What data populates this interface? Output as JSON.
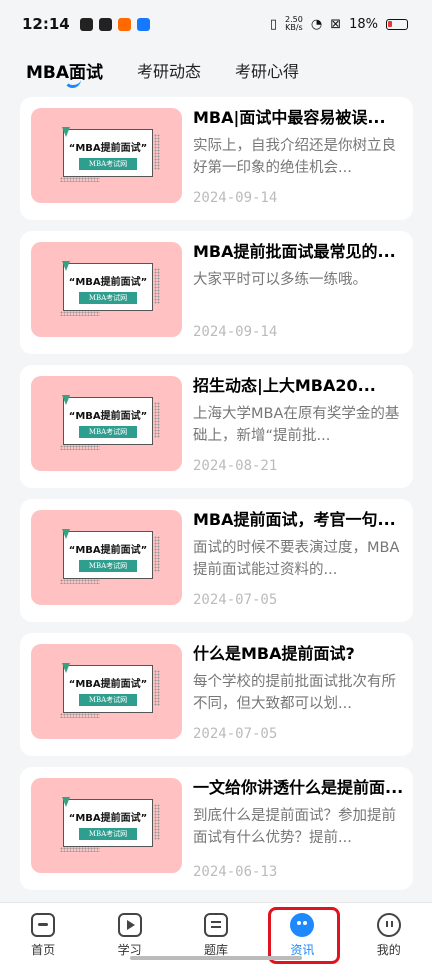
{
  "status": {
    "time": "12:14",
    "speed_value": "2.50",
    "speed_unit": "KB/s",
    "battery": "18%"
  },
  "tabs": [
    {
      "label": "MBA面试",
      "active": true
    },
    {
      "label": "考研动态",
      "active": false
    },
    {
      "label": "考研心得",
      "active": false
    }
  ],
  "thumbnail": {
    "title": "“MBA提前面试”",
    "badge": "MBA考试网"
  },
  "articles": [
    {
      "title": "MBA|面试中最容易被误...",
      "summary": "实际上，自我介绍还是你树立良好第一印象的绝佳机会...",
      "date": "2024-09-14"
    },
    {
      "title": "MBA提前批面试最常见的...",
      "summary": "大家平时可以多练一练哦。",
      "date": "2024-09-14"
    },
    {
      "title": "招生动态|上大MBA20...",
      "summary": "上海大学MBA在原有奖学金的基础上，新增“提前批...",
      "date": "2024-08-21"
    },
    {
      "title": "MBA提前面试，考官一句...",
      "summary": "面试的时候不要表演过度，MBA提前面试能过资料的...",
      "date": "2024-07-05"
    },
    {
      "title": "什么是MBA提前面试?",
      "summary": "每个学校的提前批面试批次有所不同，但大致都可以划...",
      "date": "2024-07-05"
    },
    {
      "title": "一文给你讲透什么是提前面...",
      "summary": "到底什么是提前面试？参加提前面试有什么优势？提前...",
      "date": "2024-06-13"
    }
  ],
  "bottom_nav": [
    {
      "label": "首页",
      "icon": "home-icon",
      "active": false
    },
    {
      "label": "学习",
      "icon": "play-icon",
      "active": false
    },
    {
      "label": "题库",
      "icon": "question-bank-icon",
      "active": false
    },
    {
      "label": "资讯",
      "icon": "news-icon",
      "active": true
    },
    {
      "label": "我的",
      "icon": "profile-icon",
      "active": false
    }
  ],
  "colors": {
    "accent": "#1e88ff",
    "thumbnail_bg": "#ffc1c1",
    "highlight": "#e0141e"
  }
}
